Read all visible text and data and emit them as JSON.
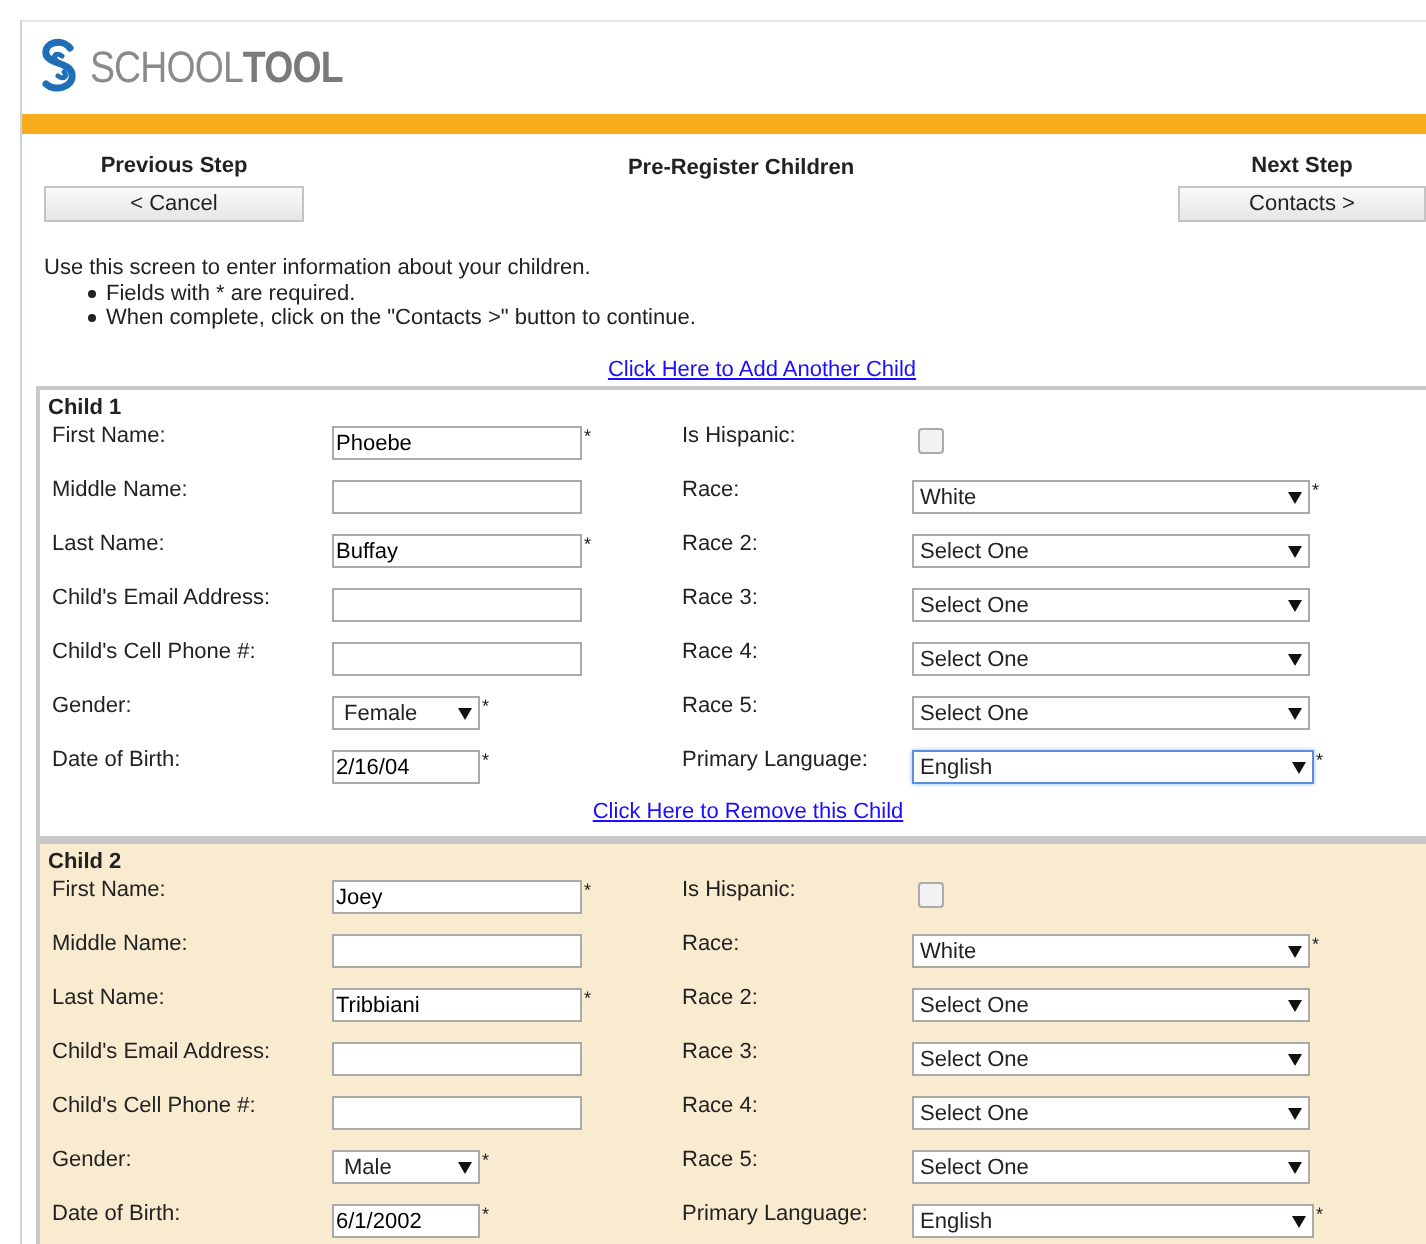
{
  "header": {
    "logo_text": "SCHOOL**TOOL**"
  },
  "steps": {
    "previous": {
      "heading": "Previous Step",
      "button": "< Cancel"
    },
    "title": "Pre-Register Children",
    "next": {
      "heading": "Next Step",
      "button": "Contacts >"
    }
  },
  "instructions": {
    "intro": "Use this screen to enter information about your children.",
    "bullets": [
      "Fields with * are required.",
      "When complete, click on the \"Contacts >\" button to continue."
    ]
  },
  "add_child_link": "Click Here to Add Another Child",
  "children": [
    {
      "title": "Child 1",
      "highlighted": false,
      "remove_link": "Click Here to Remove this Child",
      "rows": [
        [
          {
            "label": "First Name:",
            "kind": "text",
            "value": "Phoebe",
            "mark": "*"
          },
          {
            "label": "Is Hispanic:",
            "kind": "checkbox",
            "checked": false
          }
        ],
        [
          {
            "label": "Middle Name:",
            "kind": "text"
          },
          {
            "label": "Race:",
            "kind": "select",
            "value": "White",
            "mark": "*"
          }
        ],
        [
          {
            "label": "Last Name:",
            "kind": "text",
            "value": "Buffay",
            "mark": "*"
          },
          {
            "label": "Race 2:",
            "kind": "select",
            "value": "Select One"
          }
        ],
        [
          {
            "label": "Child's Email Address:",
            "kind": "text"
          },
          {
            "label": "Race 3:",
            "kind": "select",
            "value": "Select One"
          }
        ],
        [
          {
            "label": "Child's Cell Phone #:",
            "kind": "text"
          },
          {
            "label": "Race 4:",
            "kind": "select",
            "value": "Select One"
          }
        ],
        [
          {
            "label": "Gender:",
            "kind": "short-select",
            "value": "Female",
            "mark": "*"
          },
          {
            "label": "Race 5:",
            "kind": "select",
            "value": "Select One"
          }
        ],
        [
          {
            "label": "Date of Birth:",
            "kind": "short-text",
            "value": "2/16/04",
            "mark": "*"
          },
          {
            "label": "Primary Language:",
            "kind": "wide-select",
            "value": "English",
            "mark": "*",
            "focused": true
          }
        ]
      ]
    },
    {
      "title": "Child 2",
      "highlighted": true,
      "rows": [
        [
          {
            "label": "First Name:",
            "kind": "text",
            "value": "Joey",
            "mark": "*"
          },
          {
            "label": "Is Hispanic:",
            "kind": "checkbox",
            "checked": false
          }
        ],
        [
          {
            "label": "Middle Name:",
            "kind": "text"
          },
          {
            "label": "Race:",
            "kind": "select",
            "value": "White",
            "mark": "*"
          }
        ],
        [
          {
            "label": "Last Name:",
            "kind": "text",
            "value": "Tribbiani",
            "mark": "*"
          },
          {
            "label": "Race 2:",
            "kind": "select",
            "value": "Select One"
          }
        ],
        [
          {
            "label": "Child's Email Address:",
            "kind": "text"
          },
          {
            "label": "Race 3:",
            "kind": "select",
            "value": "Select One"
          }
        ],
        [
          {
            "label": "Child's Cell Phone #:",
            "kind": "text"
          },
          {
            "label": "Race 4:",
            "kind": "select",
            "value": "Select One"
          }
        ],
        [
          {
            "label": "Gender:",
            "kind": "short-select",
            "value": "Male",
            "mark": "*"
          },
          {
            "label": "Race 5:",
            "kind": "select",
            "value": "Select One"
          }
        ],
        [
          {
            "label": "Date of Birth:",
            "kind": "short-text",
            "value": "6/1/2002",
            "mark": "*"
          },
          {
            "label": "Primary Language:",
            "kind": "wide-select",
            "value": "English",
            "mark": "*",
            "focused": false
          }
        ]
      ]
    }
  ]
}
